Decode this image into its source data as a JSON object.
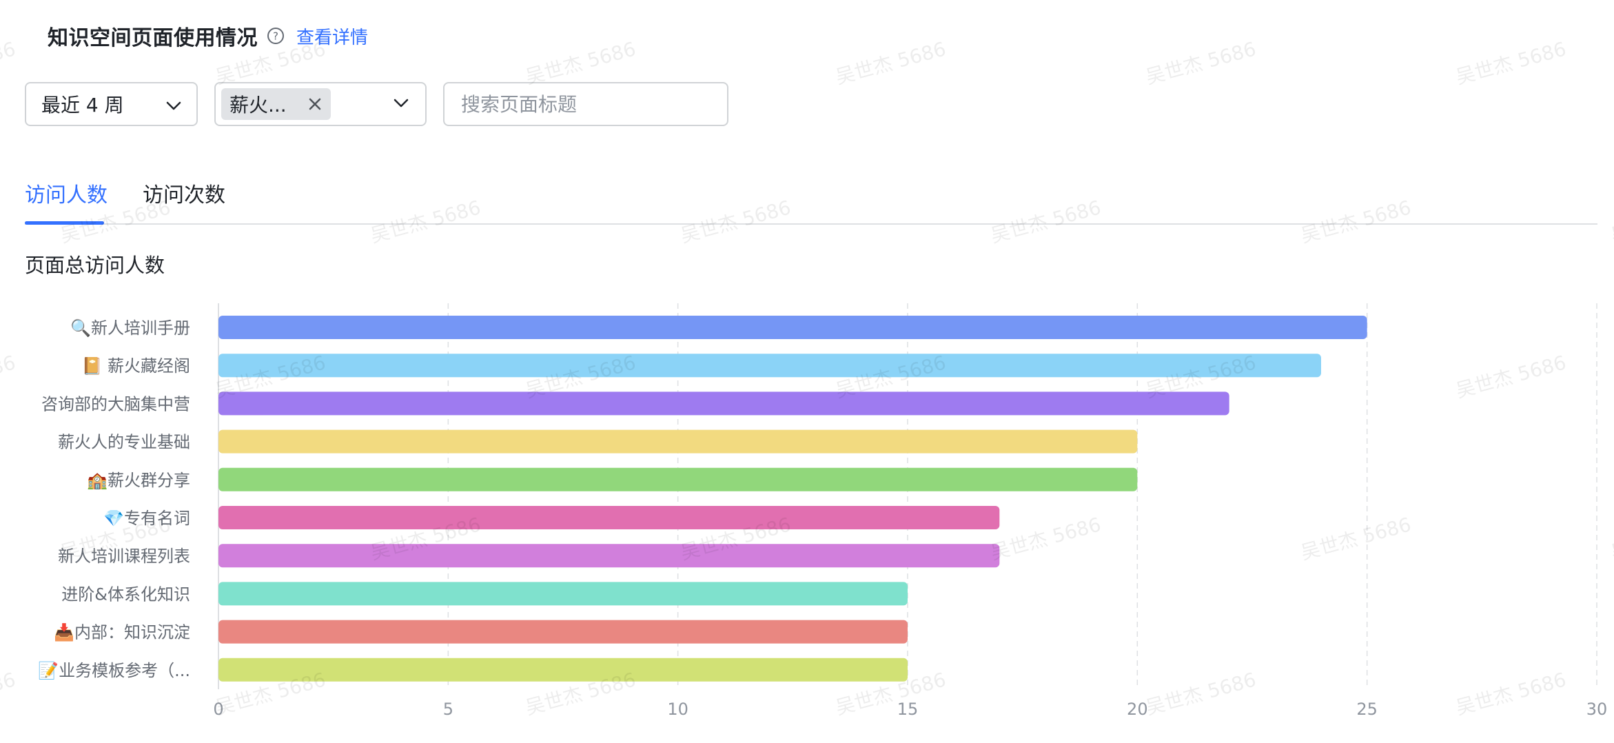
{
  "header": {
    "title": "知识空间页面使用情况",
    "help_icon": "question-circle-icon",
    "detail_link": "查看详情"
  },
  "filters": {
    "period": {
      "value": "最近 4 周",
      "icon": "chevron-down-icon"
    },
    "space": {
      "tag": "薪火...",
      "close_icon": "close-icon",
      "icon": "chevron-down-icon"
    },
    "search": {
      "placeholder": "搜索页面标题"
    }
  },
  "tabs": [
    {
      "label": "访问人数",
      "active": true
    },
    {
      "label": "访问次数",
      "active": false
    }
  ],
  "section_title": "页面总访问人数",
  "accent_color": "#3370ff",
  "watermark_text": "吴世杰 5686",
  "chart_data": {
    "type": "bar",
    "orientation": "horizontal",
    "categories": [
      "🔍新人培训手册",
      "📔 薪火藏经阁",
      "咨询部的大脑集中营",
      "薪火人的专业基础",
      "🏫薪火群分享",
      "💎专有名词",
      "新人培训课程列表",
      "进阶&体系化知识",
      "📥内部：知识沉淀",
      "📝业务模板参考（..."
    ],
    "values": [
      25,
      24,
      22,
      20,
      20,
      17,
      17,
      15,
      15,
      15
    ],
    "colors": [
      "#7596f5",
      "#8bd3f7",
      "#9e7bf0",
      "#f2da80",
      "#91d77b",
      "#e16fb0",
      "#d17fdc",
      "#7fe1cd",
      "#e98781",
      "#d1e175"
    ],
    "x_ticks": [
      "0",
      "5",
      "10",
      "15",
      "20",
      "25",
      "30"
    ],
    "xlim": [
      0,
      30
    ],
    "grid": true
  }
}
